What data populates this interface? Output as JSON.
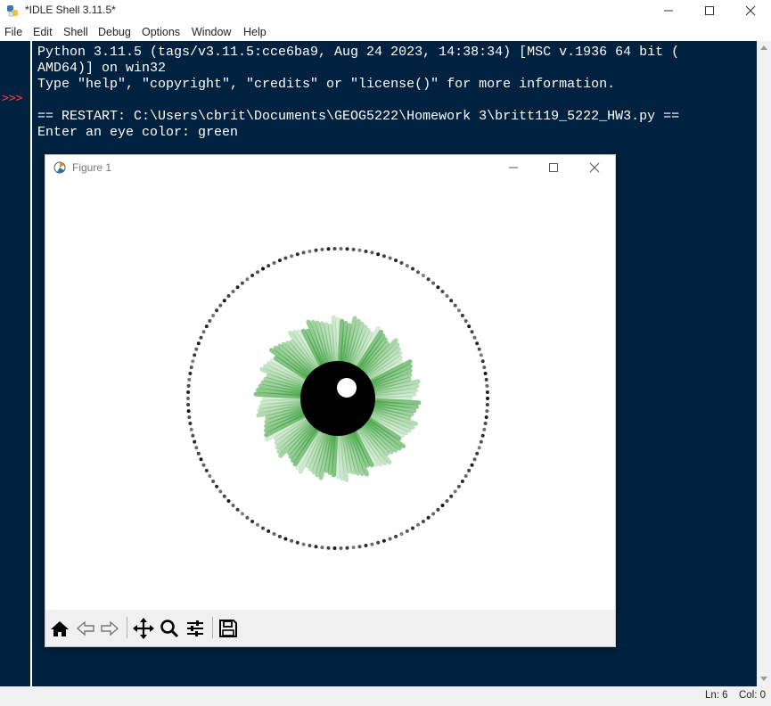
{
  "window": {
    "title": "*IDLE Shell 3.11.5*"
  },
  "menu": [
    "File",
    "Edit",
    "Shell",
    "Debug",
    "Options",
    "Window",
    "Help"
  ],
  "shell": {
    "prompt": ">>>",
    "lines": [
      "Python 3.11.5 (tags/v3.11.5:cce6ba9, Aug 24 2023, 14:38:34) [MSC v.1936 64 bit (",
      "AMD64)] on win32",
      "Type \"help\", \"copyright\", \"credits\" or \"license()\" for more information.",
      "== RESTART: C:\\Users\\cbrit\\Documents\\GEOG5222\\Homework 3\\britt119_5222_HW3.py ==",
      "Enter an eye color: green"
    ]
  },
  "status": {
    "line": "Ln: 6",
    "col": "Col: 0"
  },
  "figure": {
    "title": "Figure 1",
    "iris_color": "#2e9a2e"
  },
  "colors": {
    "shell_bg": "#002240",
    "prompt": "#ff3b3b"
  }
}
